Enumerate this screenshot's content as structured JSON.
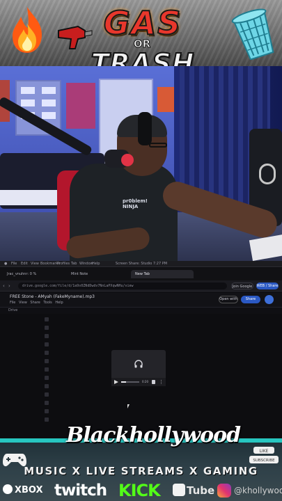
{
  "banner": {
    "title_gas": "GAS",
    "title_or": "OR",
    "title_trash": "TRASH"
  },
  "webcam": {
    "shirt_print": "pr0blem! NINJA"
  },
  "screen": {
    "os_bar": {
      "menu_items": [
        "File",
        "Edit",
        "View",
        "Bookmarks",
        "Profiles",
        "Tab",
        "Window",
        "Help"
      ],
      "center_text": "Screen Share: Studio  7:27 PM"
    },
    "browser": {
      "tabs": [
        {
          "label": "Jrac_vnuhnr: 0 %",
          "active": false
        },
        {
          "label": "Mint Note",
          "active": false
        },
        {
          "label": "New Tab",
          "active": true
        }
      ],
      "url": "drive.google.com/file/d/1a9s0ZNdDwdv7NnLaPXqwNHu/view",
      "buttons": {
        "signin": "Join Google",
        "profile": "WEB / Share"
      }
    },
    "doc": {
      "title": "FREE Stone - AMyah (FakeMyname).mp3",
      "menu": "File  View  Share  Tools  Help",
      "open_label": "Open with",
      "share_label": "Share"
    },
    "drive_label": "Drive",
    "files": [
      {
        "name": "",
        "meta": ""
      },
      {
        "name": "",
        "meta": ""
      },
      {
        "name": "",
        "meta": ""
      },
      {
        "name": "",
        "meta": ""
      },
      {
        "name": "",
        "meta": ""
      },
      {
        "name": "",
        "meta": ""
      },
      {
        "name": "",
        "meta": ""
      },
      {
        "name": "",
        "meta": ""
      },
      {
        "name": "",
        "meta": ""
      },
      {
        "name": "",
        "meta": ""
      },
      {
        "name": "",
        "meta": ""
      },
      {
        "name": "",
        "meta": ""
      },
      {
        "name": "",
        "meta": ""
      }
    ],
    "player": {
      "time": "0:20",
      "progress": 0.28
    }
  },
  "footer": {
    "brand": "Blackhollywood",
    "tagline": "MUSIC X LIVE STREAMS X GAMING",
    "logos": {
      "xbox": "XBOX",
      "twitch": "twitch",
      "kick": "KICK",
      "youtube": "Tube",
      "instagram_handle": "@khollywood"
    }
  },
  "colors": {
    "kick_green": "#53fc18",
    "accent_teal": "#27c6c0",
    "gas_red": "#e8372c",
    "share_blue": "#2b59c3"
  },
  "icons": [
    "fire-icon",
    "trash-can-icon",
    "gas-nozzle-icon",
    "controller-icon",
    "subscribe-icon",
    "headphones-icon",
    "play-icon",
    "volume-icon",
    "instagram-icon",
    "xbox-icon",
    "youtube-icon"
  ]
}
